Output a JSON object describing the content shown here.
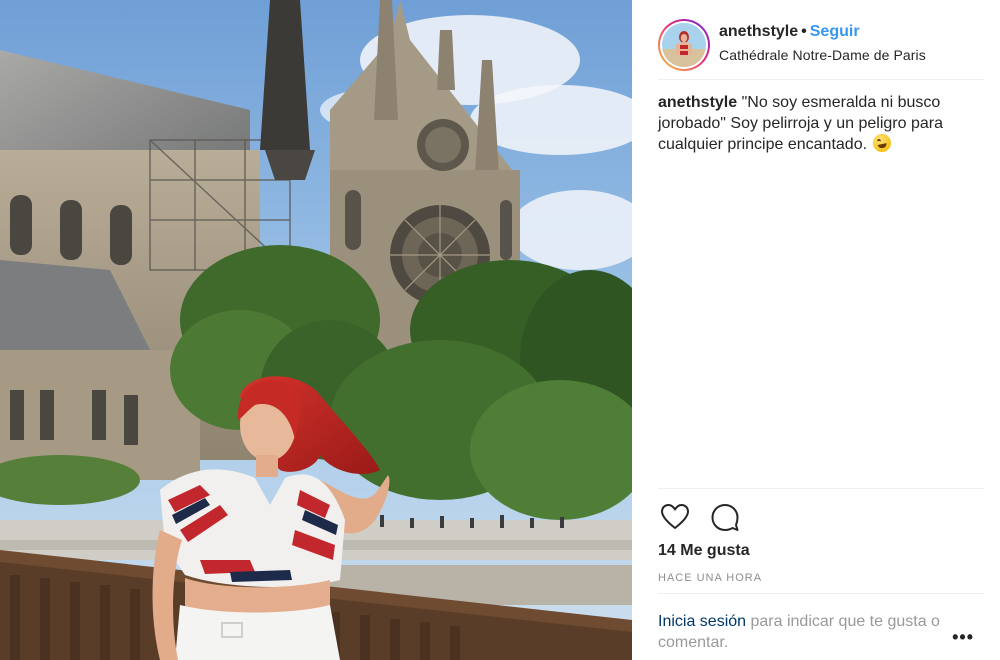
{
  "post": {
    "photo_alt": "",
    "header": {
      "username": "anethstyle",
      "separator": "•",
      "follow_label": "Seguir",
      "location": "Cathédrale Notre-Dame de Paris"
    },
    "caption": {
      "username": "anethstyle",
      "text": "\"No soy esmeralda ni busco jorobado\" Soy pelirroja y un peligro para cualquier principe encantado."
    },
    "likes": "14 Me gusta",
    "timestamp": "HACE UNA HORA",
    "login_prompt": {
      "link_label": "Inicia sesión",
      "rest": " para indicar que te gusta o comentar."
    },
    "more_options": "•••"
  },
  "icons": {
    "like": "heart-icon",
    "comment": "comment-icon",
    "emoji": "rofl-emoji-icon",
    "more": "more-options-icon"
  },
  "colors": {
    "follow": "#3897f0",
    "text": "#262626",
    "muted": "#8e8e8e",
    "link": "#00376b",
    "divider": "#efefef"
  }
}
